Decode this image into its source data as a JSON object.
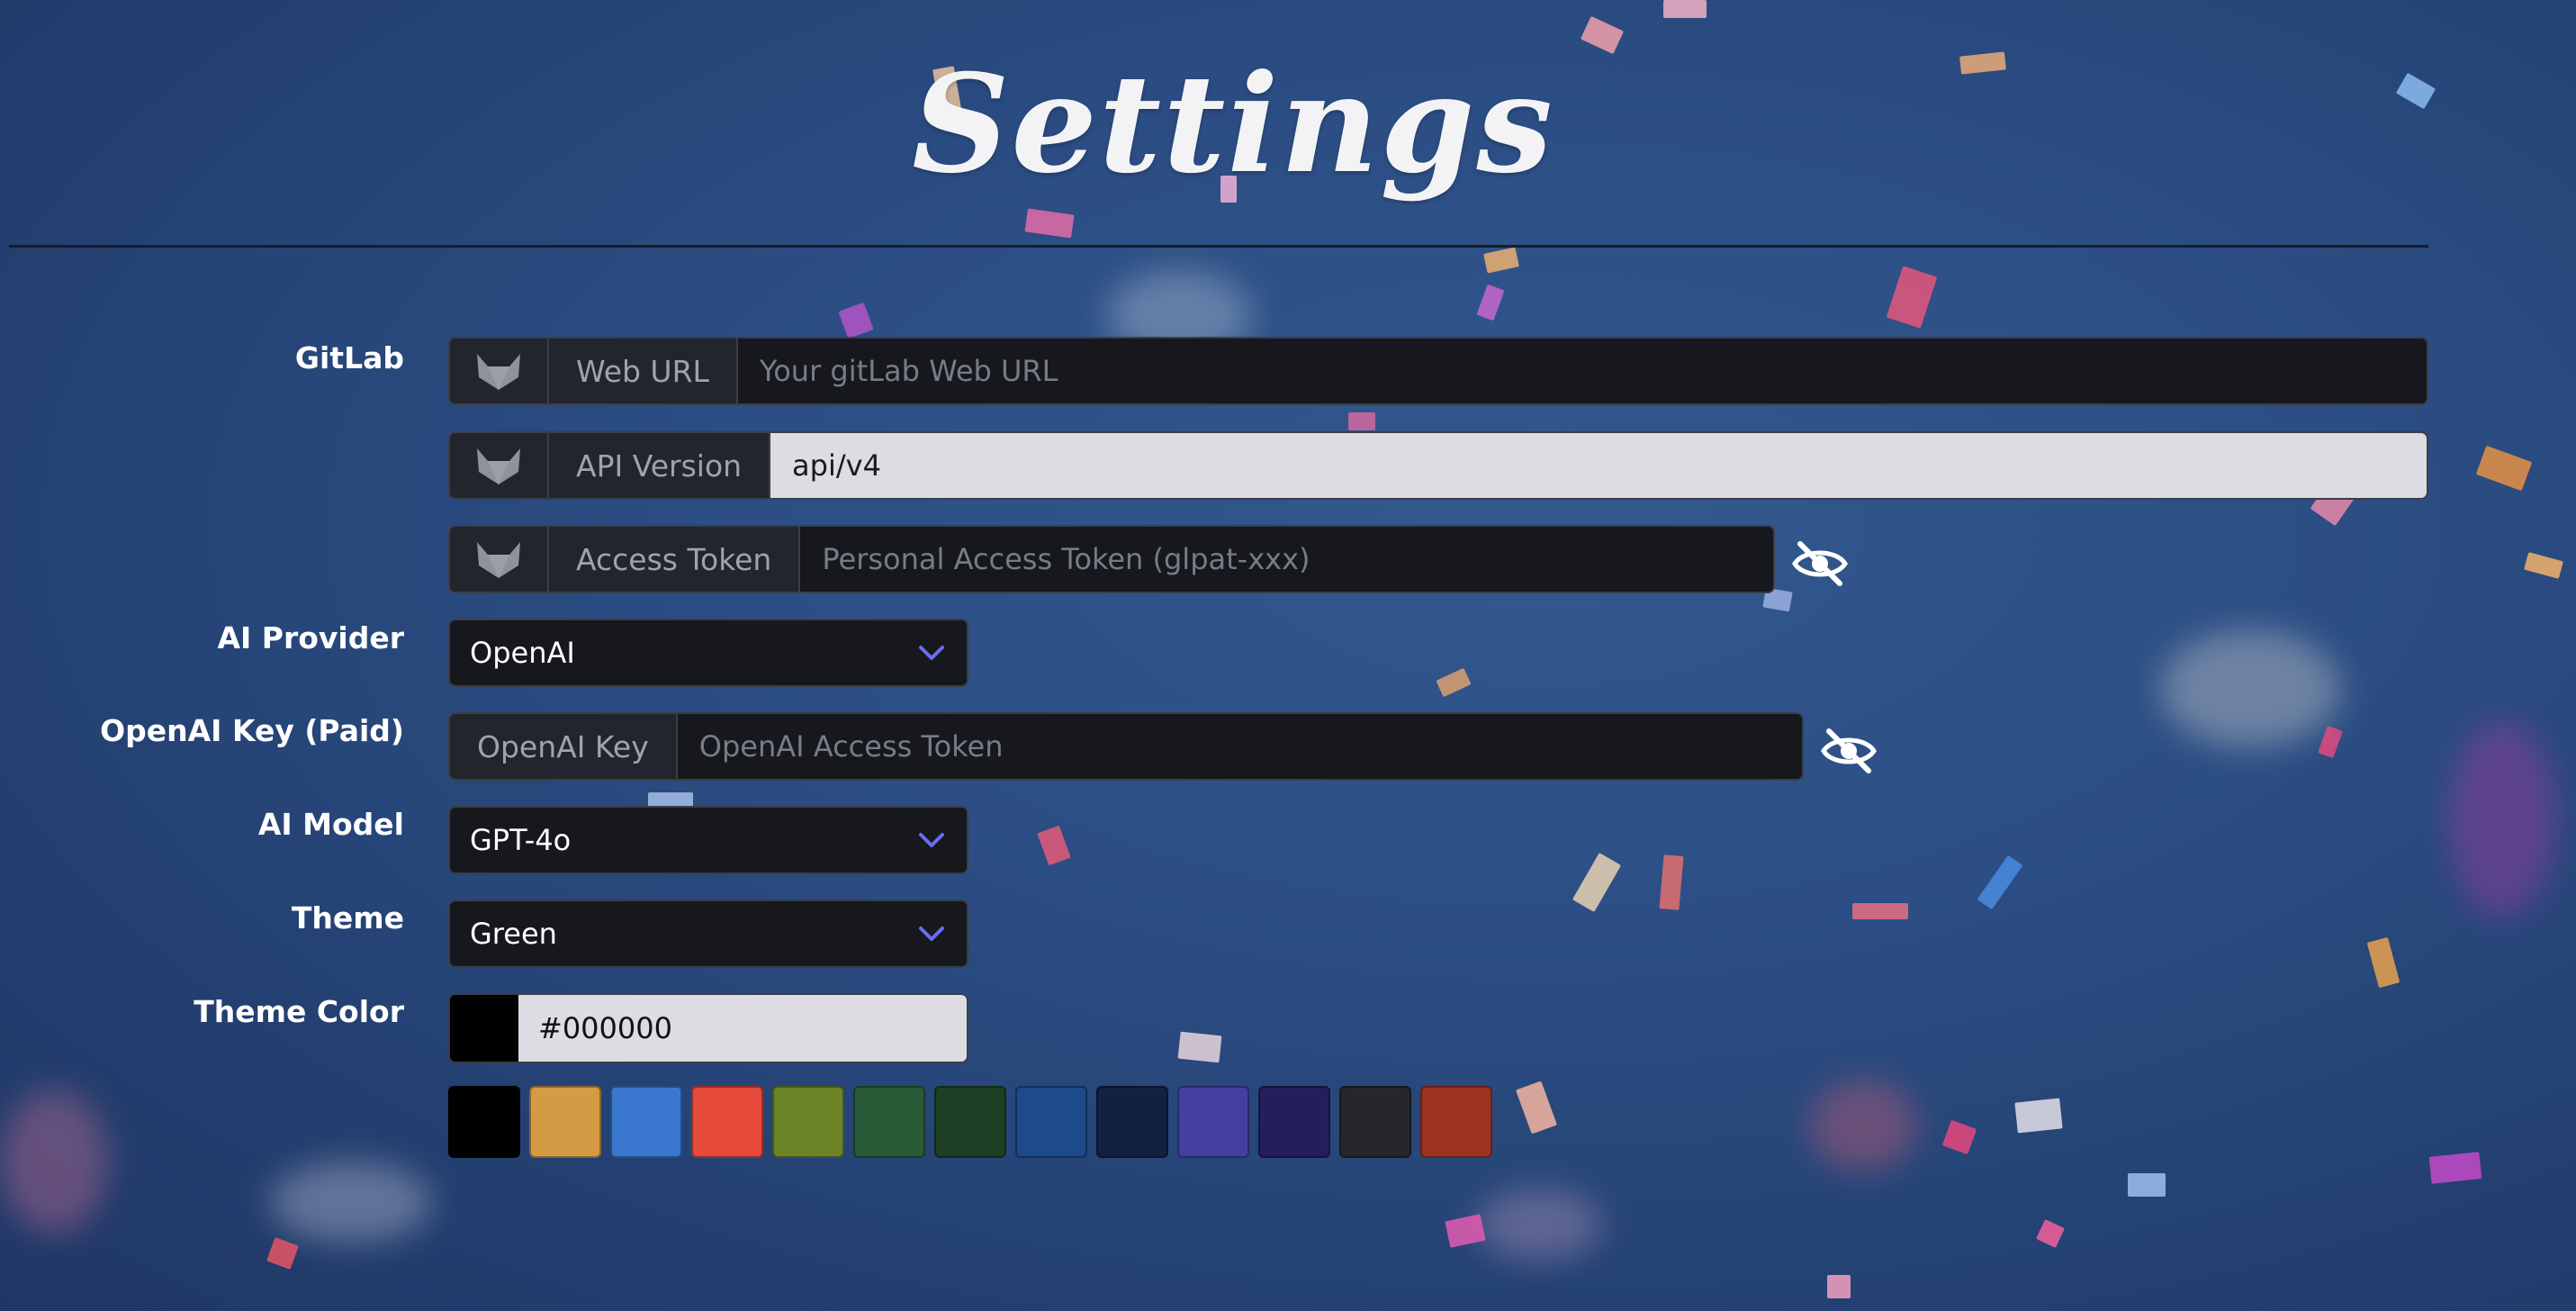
{
  "page": {
    "title": "Settings"
  },
  "gitlab": {
    "label": "GitLab",
    "web_url": {
      "addon": "Web URL",
      "placeholder": "Your gitLab Web URL",
      "value": ""
    },
    "api_version": {
      "addon": "API Version",
      "value": "api/v4"
    },
    "access_token": {
      "addon": "Access Token",
      "placeholder": "Personal Access Token (glpat-xxx)",
      "value": ""
    }
  },
  "ai_provider": {
    "label": "AI Provider",
    "selected": "OpenAI"
  },
  "openai_key": {
    "label": "OpenAI Key (Paid)",
    "addon": "OpenAI Key",
    "placeholder": "OpenAI Access Token",
    "value": ""
  },
  "ai_model": {
    "label": "AI Model",
    "selected": "GPT-4o"
  },
  "theme": {
    "label": "Theme",
    "selected": "Green"
  },
  "theme_color": {
    "label": "Theme Color",
    "value": "#000000",
    "swatches": [
      "#000000",
      "#d49b45",
      "#3a78cf",
      "#e64a3b",
      "#6b8526",
      "#2a5b38",
      "#1d4025",
      "#1c4a8a",
      "#12213f",
      "#4340a0",
      "#231f5c",
      "#26272c",
      "#9c3320"
    ]
  },
  "icons": {
    "gitlab": "gitlab-fox-icon",
    "eye": "eye-off-icon",
    "chevron": "chevron-down-icon"
  },
  "colors": {
    "accent": "#6b6cf2",
    "field_bg": "#16181d",
    "light_field_bg": "#dcdce2"
  }
}
